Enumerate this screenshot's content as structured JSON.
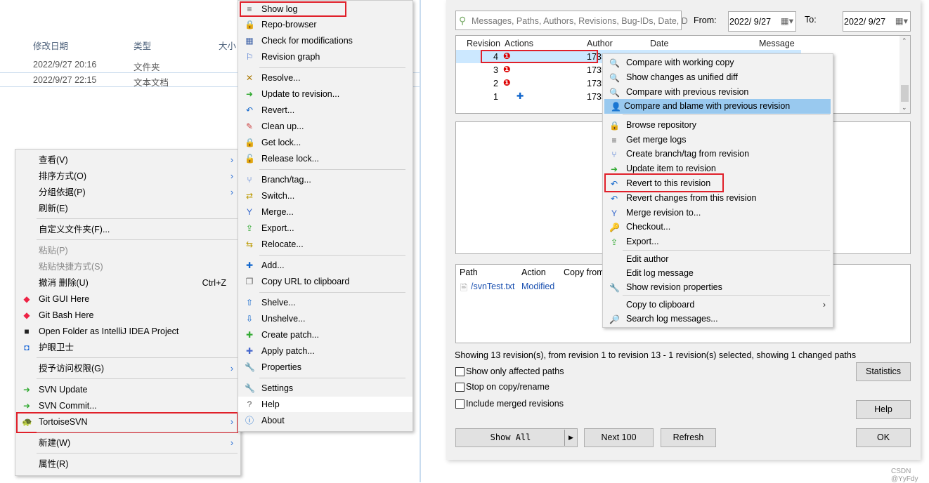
{
  "explorer": {
    "columns": [
      "修改日期",
      "类型",
      "大小"
    ],
    "rows": [
      {
        "date": "2022/9/27 20:16",
        "type": "文件夹"
      },
      {
        "date": "2022/9/27 22:15",
        "type": "文本文档"
      }
    ]
  },
  "context_menu": {
    "items": [
      {
        "label": "查看(V)",
        "arrow": true
      },
      {
        "label": "排序方式(O)",
        "arrow": true
      },
      {
        "label": "分组依据(P)",
        "arrow": true
      },
      {
        "label": "刷新(E)"
      },
      {
        "label": "自定义文件夹(F)..."
      },
      {
        "label": "粘贴(P)",
        "disabled": true
      },
      {
        "label": "粘贴快捷方式(S)",
        "disabled": true
      },
      {
        "label": "撤消 删除(U)",
        "shortcut": "Ctrl+Z"
      },
      {
        "label": "Git GUI Here",
        "icon": "git-icon"
      },
      {
        "label": "Git Bash Here",
        "icon": "git-icon"
      },
      {
        "label": "Open Folder as IntelliJ IDEA Project",
        "icon": "intellij-icon"
      },
      {
        "label": "护眼卫士",
        "icon": "shield-icon"
      },
      {
        "label": "授予访问权限(G)",
        "arrow": true
      },
      {
        "label": "SVN Update",
        "icon": "svn-update-icon"
      },
      {
        "label": "SVN Commit...",
        "icon": "svn-commit-icon"
      },
      {
        "label": "TortoiseSVN",
        "icon": "tortoisesvn-icon",
        "arrow": true,
        "highlighted": true
      },
      {
        "label": "新建(W)",
        "arrow": true
      },
      {
        "label": "属性(R)"
      }
    ]
  },
  "svn_menu": {
    "items": [
      "Show log",
      "Repo-browser",
      "Check for modifications",
      "Revision graph",
      "Resolve...",
      "Update to revision...",
      "Revert...",
      "Clean up...",
      "Get lock...",
      "Release lock...",
      "Branch/tag...",
      "Switch...",
      "Merge...",
      "Export...",
      "Relocate...",
      "Add...",
      "Copy URL to clipboard",
      "Shelve...",
      "Unshelve...",
      "Create patch...",
      "Apply patch...",
      "Properties",
      "Settings",
      "Help",
      "About"
    ],
    "hovered": "Help"
  },
  "log_dialog": {
    "search_placeholder": "Messages, Paths, Authors, Revisions, Bug-IDs, Date, D",
    "from_label": "From:",
    "from_value": "2022/  9/27",
    "to_label": "To:",
    "to_value": "2022/  9/27",
    "columns": [
      "Revision",
      "Actions",
      "Author",
      "Date",
      "Message"
    ],
    "revisions": [
      {
        "rev": "4",
        "author": "1735",
        "action": "modified"
      },
      {
        "rev": "3",
        "author": "1735",
        "action": "modified"
      },
      {
        "rev": "2",
        "author": "1735",
        "action": "modified"
      },
      {
        "rev": "1",
        "author": "1735",
        "action": "added"
      }
    ],
    "path_columns": [
      "Path",
      "Action",
      "Copy from"
    ],
    "paths": [
      {
        "path": "/svnTest.txt",
        "action": "Modified"
      }
    ],
    "status": "Showing 13 revision(s), from revision 1 to revision 13 - 1 revision(s) selected, showing 1 changed paths",
    "checkboxes": [
      {
        "label": "Show only affected paths",
        "checked": false
      },
      {
        "label": "Stop on copy/rename",
        "checked": false
      },
      {
        "label": "Include merged revisions",
        "checked": false
      }
    ],
    "buttons": {
      "statistics": "Statistics",
      "help": "Help",
      "show_all": "Show All",
      "next": "Next 100",
      "refresh": "Refresh",
      "ok": "OK"
    }
  },
  "log_menu": {
    "items": [
      "Compare with working copy",
      "Show changes as unified diff",
      "Compare with previous revision",
      "Compare and blame with previous revision",
      "Browse repository",
      "Get merge logs",
      "Create branch/tag from revision",
      "Update item to revision",
      "Revert to this revision",
      "Revert changes from this revision",
      "Merge revision to...",
      "Checkout...",
      "Export...",
      "Edit author",
      "Edit log message",
      "Show revision properties",
      "Copy to clipboard",
      "Search log messages..."
    ],
    "highlighted": "Compare and blame with previous revision",
    "boxed": "Revert to this revision",
    "highlight_color": "#99c9ef"
  },
  "watermark": "CSDN @YyFdy"
}
